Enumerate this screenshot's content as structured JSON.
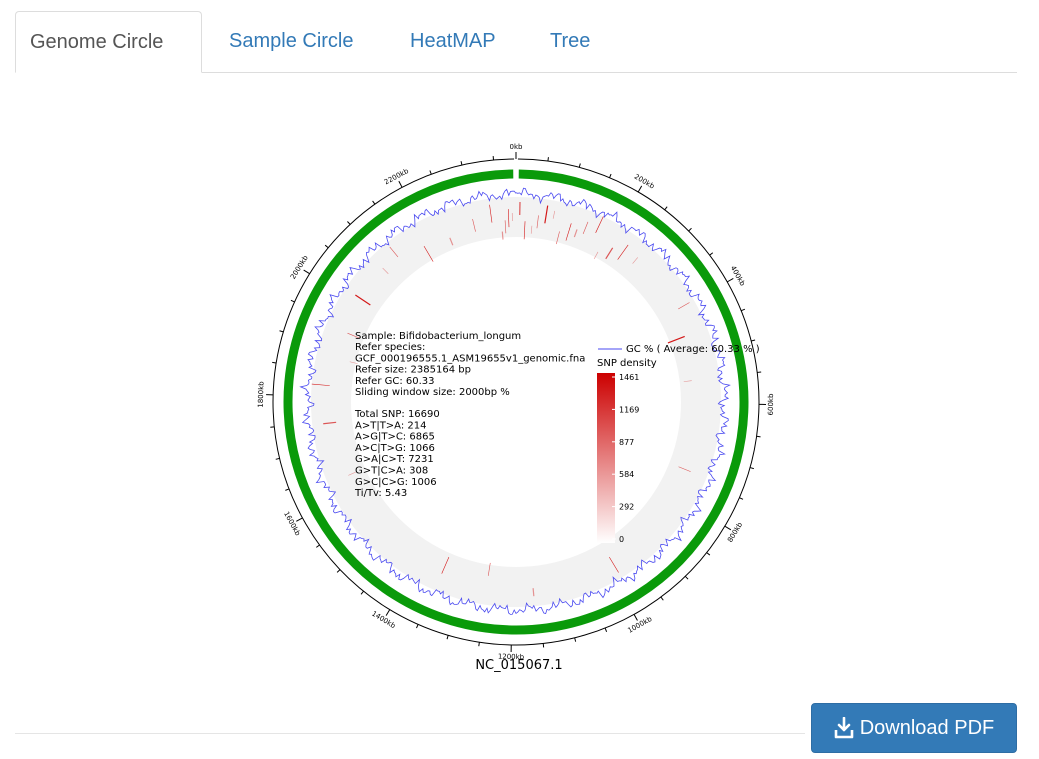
{
  "tabs": [
    {
      "label": "Genome Circle",
      "active": true
    },
    {
      "label": "Sample Circle",
      "active": false
    },
    {
      "label": "HeatMAP",
      "active": false
    },
    {
      "label": "Tree",
      "active": false
    }
  ],
  "download_button": {
    "label": "Download PDF",
    "icon": "download-icon"
  },
  "chart_data": {
    "type": "circular-genome",
    "title": "NC_015067.1",
    "genome_size_bp": 2385164,
    "tick_labels": [
      "0kb",
      "200kb",
      "400kb",
      "600kb",
      "800kb",
      "1000kb",
      "1200kb",
      "1400kb",
      "1600kb",
      "1800kb",
      "2000kb",
      "2200kb"
    ],
    "info_lines": [
      "Sample: Bifidobacterium_longum",
      "Refer species:",
      "GCF_000196555.1_ASM19655v1_genomic.fna",
      "Refer size: 2385164 bp",
      "Refer GC: 60.33",
      "Sliding window size: 2000bp %"
    ],
    "stats_lines": [
      "Total SNP: 16690",
      "A>T|T>A: 214",
      "A>G|T>C: 6865",
      "A>C|T>G: 1066",
      "G>A|C>T: 7231",
      "G>T|C>A: 308",
      "G>C|C>G: 1006",
      "Ti/Tv: 5.43"
    ],
    "gc_legend": "GC % ( Average: 60.33 % )",
    "snp_legend": {
      "title": "SNP density",
      "scale_values": [
        "1461",
        "1169",
        "877",
        "584",
        "292",
        "0"
      ],
      "max": 1461
    },
    "colors": {
      "backbone": "#0a9a0a",
      "gc_line": "#4a4af0",
      "snp": "#d00000",
      "track_bg": "#f2f2f2"
    }
  }
}
